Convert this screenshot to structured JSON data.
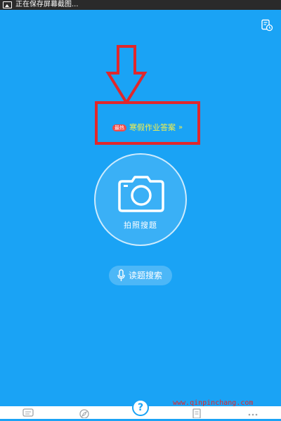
{
  "status_bar": {
    "notification_icon": "image-icon",
    "text": "正在保存屏幕截图..."
  },
  "header": {
    "history_icon": "history-document-icon"
  },
  "promo": {
    "badge": "最热",
    "text": "寒假作业答案",
    "chevron": "»"
  },
  "camera_search": {
    "label": "拍照搜题",
    "icon": "camera-icon"
  },
  "voice_search": {
    "label": "读题搜索",
    "icon": "microphone-icon"
  },
  "annotation": {
    "arrow_color": "#e0272c",
    "box_color": "#e0272c"
  },
  "watermark": {
    "text": "www.qinpinchang.com"
  },
  "bottom_nav": {
    "items": [
      {
        "icon": "chat-icon"
      },
      {
        "icon": "compass-icon"
      },
      {
        "icon": "question-icon",
        "glyph": "?"
      },
      {
        "icon": "document-icon"
      },
      {
        "icon": "more-icon"
      }
    ]
  },
  "colors": {
    "background": "#1aa3f5",
    "promo_text": "#f6f04a",
    "badge": "#f04a48"
  }
}
